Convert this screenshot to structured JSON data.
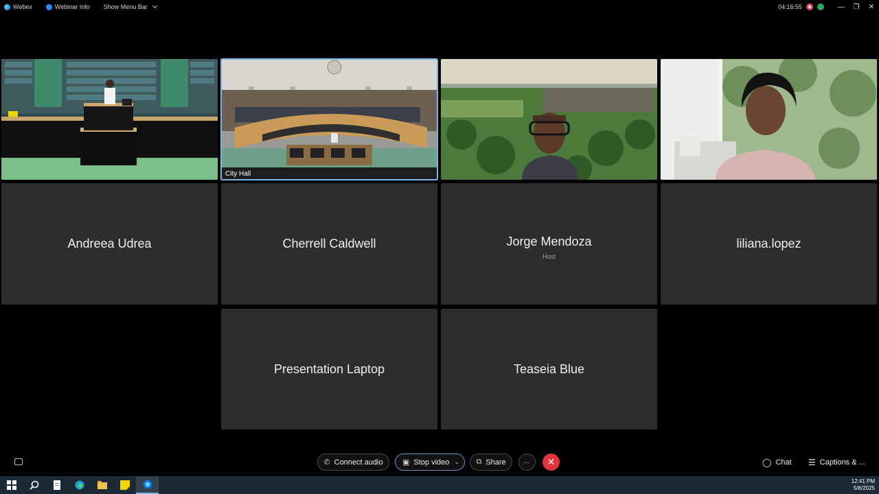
{
  "titlebar": {
    "app_name": "Webex",
    "webinar_info": "Webinar Info",
    "show_menu_bar": "Show Menu Bar",
    "time": "04:16:55"
  },
  "video_tiles": [
    {
      "label": ""
    },
    {
      "label": "City Hall"
    },
    {
      "label": ""
    },
    {
      "label": ""
    }
  ],
  "participants": [
    {
      "name": "Andreea Udrea",
      "role": ""
    },
    {
      "name": "Cherrell Caldwell",
      "role": ""
    },
    {
      "name": "Jorge Mendoza",
      "role": "Host"
    },
    {
      "name": "liliana.lopez",
      "role": ""
    },
    {
      "name": "Presentation Laptop",
      "role": ""
    },
    {
      "name": "Teaseia Blue",
      "role": ""
    }
  ],
  "controls": {
    "connect_audio": "Connect audio",
    "stop_video": "Stop video",
    "share": "Share",
    "more": "···",
    "chat": "Chat",
    "captions": "Captions & ..."
  },
  "taskbar": {
    "time": "12:41 PM",
    "date": "5/8/2025"
  },
  "colors": {
    "tile_bg": "#2d2d2d",
    "end_call": "#e0343e",
    "active_outline": "#7bb7e6",
    "taskbar_bg": "#1c2a36"
  }
}
